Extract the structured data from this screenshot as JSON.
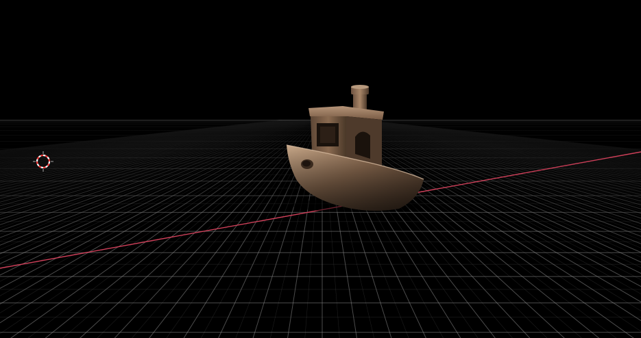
{
  "scene": {
    "background_color": "#000000",
    "floor_grid_color": "#8a8a8a",
    "x_axis_color": "#d0405a",
    "model": {
      "object": "3d-benchy-boat",
      "material_color": "#8a6a50",
      "highlight_color": "#c9a98a"
    },
    "cursor_3d": {
      "icon": "3d-cursor-icon",
      "ring_color_a": "#ff3b3b",
      "ring_color_b": "#ffffff"
    }
  }
}
